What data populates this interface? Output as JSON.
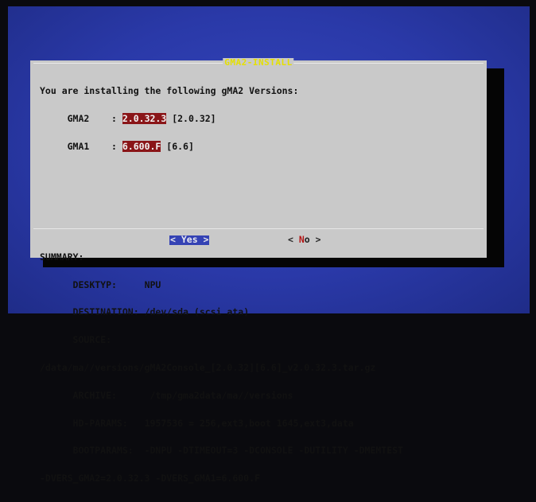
{
  "dialog": {
    "title": "GMA2-INSTALL",
    "intro": "You are installing the following gMA2 Versions:",
    "versions": [
      {
        "name": "GMA2",
        "value": "2.0.32.3",
        "bracket": "[2.0.32]"
      },
      {
        "name": "GMA1",
        "value": "6.600.F",
        "bracket": "[6.6]"
      }
    ],
    "summary_label": "SUMMARY:",
    "summary": [
      {
        "key": "DESKTYP:",
        "value": "NPU"
      },
      {
        "key": "DESTINATION:",
        "value": "/dev/sda (scsi ata)"
      },
      {
        "key": "SOURCE:",
        "value": ""
      }
    ],
    "source_path": "/data/ma//versions/gMA2Console_[2.0.32][6.6]_v2.0.32.3.tar.gz",
    "summary2": [
      {
        "key": "ARCHIVE:",
        "value": "/tmp/gma2data/ma//versions"
      },
      {
        "key": "HD-PARAMS:",
        "value": "1957536 = 256,ext3,boot 1645,ext3,data"
      },
      {
        "key": "BOOTPARAMS:",
        "value": "-DNPU -DTIMEOUT=3 -DCONSOLE -DUTILITY -DMEMTEST"
      }
    ],
    "bootparams_cont": "-DVERS_GMA2=2.0.32.3 -DVERS_GMA1=6.600.F",
    "buttons": {
      "yes": "< Yes >",
      "no_left": "< ",
      "no_hot": "N",
      "no_rest": "o",
      "no_right": " >"
    }
  },
  "colors": {
    "screen_bg": "#2b3aa8",
    "dialog_bg": "#c9c9c9",
    "title": "#e5e000",
    "highlight": "#8a1518",
    "button_selected": "#3442b4"
  }
}
